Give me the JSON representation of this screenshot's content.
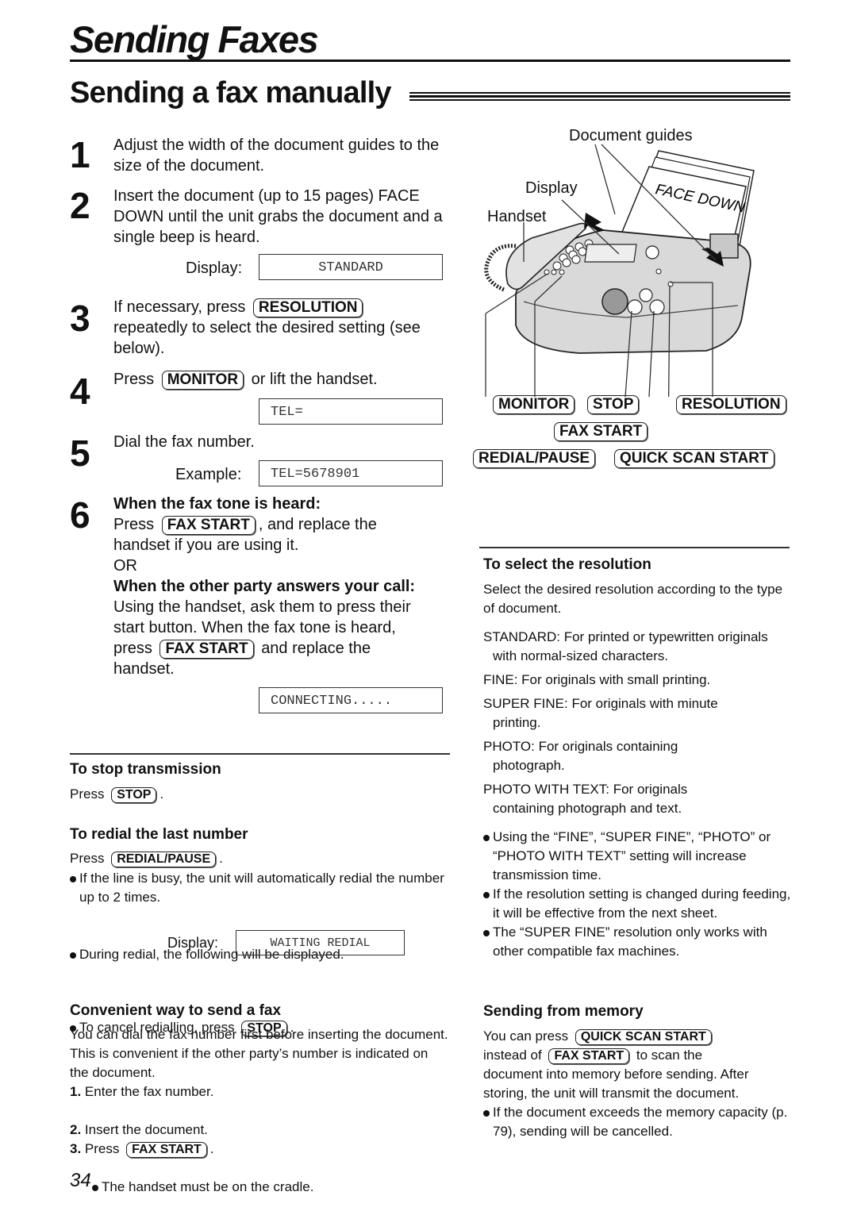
{
  "chapter_title": "Sending Faxes",
  "section_title": "Sending a fax manually",
  "steps": {
    "s1": {
      "num": "1",
      "text": "Adjust the width of the document guides to the size of the document."
    },
    "s2": {
      "num": "2",
      "text": "Insert the document (up to 15 pages) FACE DOWN until the unit grabs the document and a single beep is heard.",
      "display_label": "Display:",
      "display_value": "STANDARD"
    },
    "s3": {
      "num": "3",
      "pre": "If necessary, press",
      "key": "RESOLUTION",
      "post": "repeatedly to select the desired setting (see below)."
    },
    "s4": {
      "num": "4",
      "pre": "Press",
      "key": "MONITOR",
      "post": "or lift the handset.",
      "display_value": "TEL="
    },
    "s5": {
      "num": "5",
      "text": "Dial the fax number.",
      "example_label": "Example:",
      "display_value": "TEL=5678901"
    },
    "s6": {
      "num": "6",
      "heading1": "When the fax tone is heard:",
      "pre1": "Press",
      "key1": "FAX START",
      "post1": ", and replace the",
      "line2": "handset if you are using it.",
      "or": "OR",
      "heading2": "When the other party answers your call:",
      "line3": "Using the handset, ask them to press their",
      "line4": "start button. When the fax tone is heard,",
      "pre5": "press",
      "key2": "FAX START",
      "post5": "and replace the",
      "line6": "handset.",
      "display_value": "CONNECTING....."
    }
  },
  "diagram": {
    "labels": {
      "document_guides": "Document guides",
      "display": "Display",
      "handset": "Handset",
      "face_down": "FACE DOWN"
    },
    "keys": {
      "monitor": "MONITOR",
      "stop": "STOP",
      "resolution": "RESOLUTION",
      "fax_start": "FAX START",
      "redial_pause": "REDIAL/PAUSE",
      "quick_scan_start": "QUICK SCAN START"
    }
  },
  "stop_transmission": {
    "heading": "To stop transmission",
    "pre": "Press",
    "key": "STOP",
    "post": "."
  },
  "redial": {
    "heading": "To redial the last number",
    "pre": "Press",
    "key": "REDIAL/PAUSE",
    "post": ".",
    "bullet1": "If the line is busy, the unit will automatically redial the number up to 2 times.",
    "bullet2": "During redial, the following will be displayed.",
    "display_label": "Display:",
    "display_value": "WAITING REDIAL",
    "bullet3_pre": "To cancel redialling, press",
    "bullet3_key": "STOP",
    "bullet3_post": "."
  },
  "convenient": {
    "heading": "Convenient way to send a fax",
    "intro": "You can dial the fax number first before inserting the document. This is convenient if the other party’s number is indicated on the document.",
    "items": [
      {
        "num": "1.",
        "text": "Enter the fax number."
      },
      {
        "num": "2.",
        "text": "Insert the document."
      },
      {
        "num": "3.",
        "pre": "Press",
        "key": "FAX START",
        "post": "."
      }
    ],
    "sub_bullet": "The handset must be on the cradle."
  },
  "resolution": {
    "heading": "To select the resolution",
    "intro": "Select the desired resolution according to the type of document.",
    "options": [
      "STANDARD: For printed or typewritten originals with normal-sized characters.",
      "FINE: For originals with small printing.",
      "SUPER FINE: For originals with minute printing.",
      "PHOTO: For originals containing photograph.",
      "PHOTO WITH TEXT: For originals containing photograph and text."
    ],
    "notes": [
      "Using the “FINE”, “SUPER FINE”, “PHOTO” or “PHOTO WITH TEXT” setting will increase transmission time.",
      "If the resolution setting is changed during feeding, it will be effective from the next sheet.",
      "The “SUPER FINE” resolution only works with other compatible fax machines."
    ]
  },
  "memory": {
    "heading": "Sending from memory",
    "pre": "You can press",
    "key1": "QUICK SCAN START",
    "mid": "instead of",
    "key2": "FAX START",
    "post": "to scan the",
    "rest": "document into memory before sending. After storing, the unit will transmit the document.",
    "bullet": "If the document exceeds the memory capacity (p. 79), sending will be cancelled."
  },
  "page_number": "34"
}
